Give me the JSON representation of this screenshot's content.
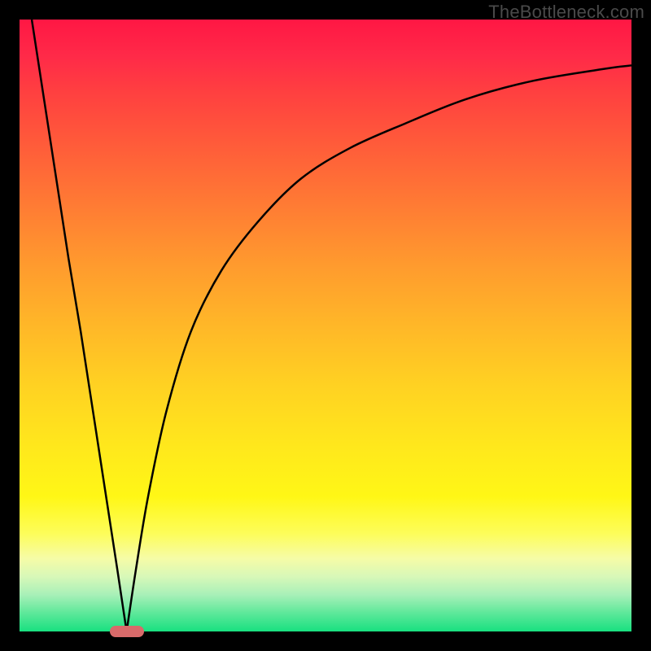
{
  "watermark": "TheBottleneck.com",
  "colors": {
    "frame": "#000000",
    "curve_stroke": "#000000",
    "marker_fill": "#d86a6a"
  },
  "chart_data": {
    "type": "line",
    "title": "",
    "xlabel": "",
    "ylabel": "",
    "xlim": [
      0,
      100
    ],
    "ylim": [
      0,
      100
    ],
    "grid": false,
    "legend": false,
    "series": [
      {
        "name": "left-branch",
        "x": [
          2,
          4,
          6,
          8,
          10,
          12,
          14,
          16,
          17.5
        ],
        "values": [
          100,
          87,
          74,
          61,
          49,
          36,
          23,
          10,
          0
        ]
      },
      {
        "name": "right-branch",
        "x": [
          17.5,
          19,
          21,
          24,
          28,
          33,
          39,
          46,
          54,
          63,
          73,
          84,
          96,
          100
        ],
        "values": [
          0,
          10,
          22,
          36,
          49,
          59,
          67,
          74,
          79,
          83,
          87,
          90,
          92,
          92.5
        ]
      }
    ],
    "annotations": [
      {
        "name": "min-marker",
        "x": 17.5,
        "y": 0,
        "shape": "pill"
      }
    ],
    "gradient_stops": [
      {
        "pos": 0.0,
        "color": "#ff1744"
      },
      {
        "pos": 0.5,
        "color": "#ffb728"
      },
      {
        "pos": 0.8,
        "color": "#fff716"
      },
      {
        "pos": 1.0,
        "color": "#18e080"
      }
    ]
  }
}
